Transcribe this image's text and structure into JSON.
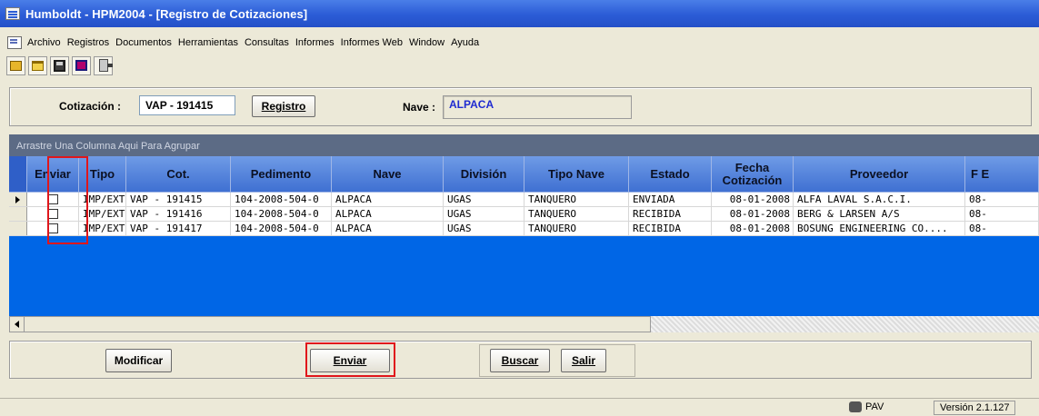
{
  "window": {
    "title": "Humboldt - HPM2004 - [Registro de Cotizaciones]"
  },
  "menu": [
    "Archivo",
    "Registros",
    "Documentos",
    "Herramientas",
    "Consultas",
    "Informes",
    "Informes Web",
    "Window",
    "Ayuda"
  ],
  "toolbar": {
    "icons": [
      "new-icon",
      "open-icon",
      "save-icon",
      "print-icon",
      "exit-icon"
    ]
  },
  "form": {
    "cotizacion_label": "Cotización :",
    "cotizacion_value": "VAP - 191415",
    "registro_button": "Registro",
    "nave_label": "Nave :",
    "nave_value": "ALPACA"
  },
  "grid": {
    "group_hint": "Arrastre Una Columna Aqui Para Agrupar",
    "columns": [
      "Enviar",
      "Tipo",
      "Cot.",
      "Pedimento",
      "Nave",
      "División",
      "Tipo Nave",
      "Estado",
      "Fecha Cotización",
      "Proveedor",
      "F E"
    ],
    "rows": [
      {
        "tipo": "IMP/EXT",
        "cot": "VAP - 191415",
        "pedimento": "104-2008-504-0",
        "nave": "ALPACA",
        "division": "UGAS",
        "tipo_nave": "TANQUERO",
        "estado": "ENVIADA",
        "fecha": "08-01-2008",
        "proveedor": "ALFA LAVAL S.A.C.I.",
        "extra": "08-"
      },
      {
        "tipo": "IMP/EXT",
        "cot": "VAP - 191416",
        "pedimento": "104-2008-504-0",
        "nave": "ALPACA",
        "division": "UGAS",
        "tipo_nave": "TANQUERO",
        "estado": "RECIBIDA",
        "fecha": "08-01-2008",
        "proveedor": "BERG & LARSEN A/S",
        "extra": "08-"
      },
      {
        "tipo": "IMP/EXT",
        "cot": "VAP - 191417",
        "pedimento": "104-2008-504-0",
        "nave": "ALPACA",
        "division": "UGAS",
        "tipo_nave": "TANQUERO",
        "estado": "RECIBIDA",
        "fecha": "08-01-2008",
        "proveedor": "BOSUNG ENGINEERING CO....",
        "extra": "08-"
      }
    ]
  },
  "actions": {
    "modificar": "Modificar",
    "enviar": "Enviar",
    "buscar": "Buscar",
    "salir": "Salir"
  },
  "status": {
    "user": "PAV",
    "version": "Versión 2.1.127"
  },
  "colors": {
    "titlebar": "#2b5cd6",
    "grid_background": "#0066e6",
    "highlight_box": "#e0161b",
    "nave_text": "#1f2bd1"
  }
}
